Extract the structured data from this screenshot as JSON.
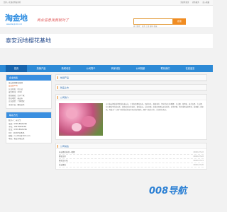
{
  "topbar": {
    "welcome": "您好，欢迎来到海金地",
    "links": [
      "淘金地首页",
      "商务服务",
      "加入收藏"
    ]
  },
  "brand": {
    "logo_text": "淘金地",
    "logo_url": "www.taojindi.com",
    "slogan": "商业信息找我就对了"
  },
  "search": {
    "button_label": "搜索",
    "hotwords": "热门搜索：商务 工商 建材 机械"
  },
  "site_title": "泰安润地樱花基地",
  "nav": {
    "items": [
      "首页",
      "热销产品",
      "新闻动态",
      "公司简介",
      "商家动态",
      "公司相册",
      "联系我们",
      "在线留言"
    ],
    "active_index": 0
  },
  "sidebar": {
    "company_header": "企业档案",
    "company_rows": [
      "泰安润地樱花基地",
      "会员第11年",
      "认证状态：已认证",
      "成立时间：2010",
      "经营模式：生产厂家",
      "所在地区：泰安市",
      "企业类型：个体经营",
      "主营产品：樱花苗木"
    ],
    "contact_header": "联系方式",
    "contact_rows": [
      "联系人：苏先生",
      "电话：0538-8826266",
      "手机：18678826266",
      "传真：0538-8826266",
      "QQ：1186792826",
      "邮箱：runditai@163.com",
      "地址：泰安市泰山区"
    ]
  },
  "main": {
    "hot_header": "热销产品",
    "new_header": "新品上市",
    "intro_header": "公司简介",
    "intro_text": "山东泰安樱花基地坐落在泰安市，主营各类樱花苗木，品种齐全，规格多样，常年供应日本晚樱、关山樱、普贤象、染井吉野、大山樱、红叶樱花等优质苗木。基地苗木长势良好，根系发达，价格合理，欢迎各界朋友来电咨询、实地考察。我们秉承诚信经营、质量第一的原则，竭诚为广大客户提供优质的苗木和完善的服务，期待与您的合作，共创美好未来。",
    "news_header": "公司动态",
    "news": [
      {
        "title": "泰安樱花基地—晚樱",
        "date": "2020-07-22"
      },
      {
        "title": "樱花苗木",
        "date": "2020-07-22"
      },
      {
        "title": "樱花苗价格",
        "date": "2020-07-21"
      },
      {
        "title": "泰安樱花",
        "date": "2020-07-20"
      }
    ]
  },
  "watermark": "008导航"
}
